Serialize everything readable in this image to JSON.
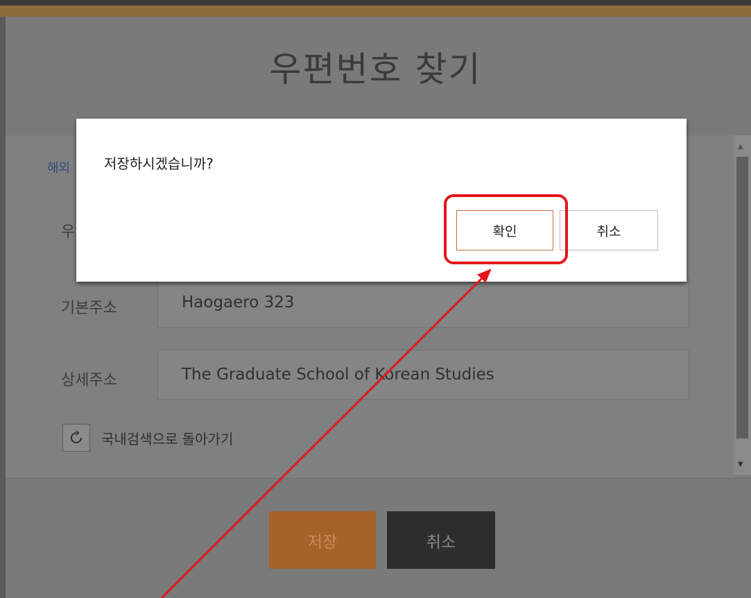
{
  "page": {
    "title": "우편번호 찾기"
  },
  "tabs": {
    "overseas_label": "해외"
  },
  "form": {
    "postcode_label": "우",
    "basic_address": {
      "label": "기본주소",
      "value": "Haogaero 323"
    },
    "detail_address": {
      "label": "상세주소",
      "value": "The Graduate School of Korean Studies"
    },
    "back_to_domestic": {
      "icon": "refresh-icon",
      "label": "국내검색으로 돌아가기"
    }
  },
  "footer": {
    "save_label": "저장",
    "cancel_label": "취소"
  },
  "dialog": {
    "message": "저장하시겠습니까?",
    "ok_label": "확인",
    "cancel_label": "취소"
  },
  "annotation": {
    "highlight_color": "#e3151a",
    "target": "확인"
  },
  "colors": {
    "save": "#a5622a",
    "cancel": "#2d2d2d",
    "accent_gold": "#8a6d3b"
  }
}
